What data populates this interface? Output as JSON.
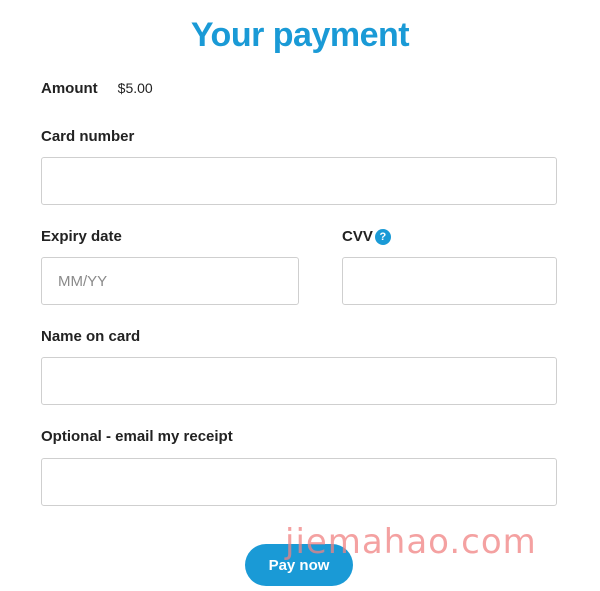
{
  "header": {
    "title": "Your payment"
  },
  "amount": {
    "label": "Amount",
    "value": "$5.00"
  },
  "form": {
    "card_number": {
      "label": "Card number",
      "value": "",
      "placeholder": ""
    },
    "expiry": {
      "label": "Expiry date",
      "value": "",
      "placeholder": "MM/YY"
    },
    "cvv": {
      "label": "CVV",
      "help_icon": "?",
      "value": "",
      "placeholder": ""
    },
    "name": {
      "label": "Name on card",
      "value": "",
      "placeholder": ""
    },
    "email": {
      "label": "Optional - email my receipt",
      "value": "",
      "placeholder": ""
    }
  },
  "actions": {
    "pay_label": "Pay now"
  },
  "watermark": "jiemahao.com",
  "colors": {
    "accent": "#1a9ad6",
    "input_border": "#cfcfcf",
    "watermark": "#f08282"
  }
}
